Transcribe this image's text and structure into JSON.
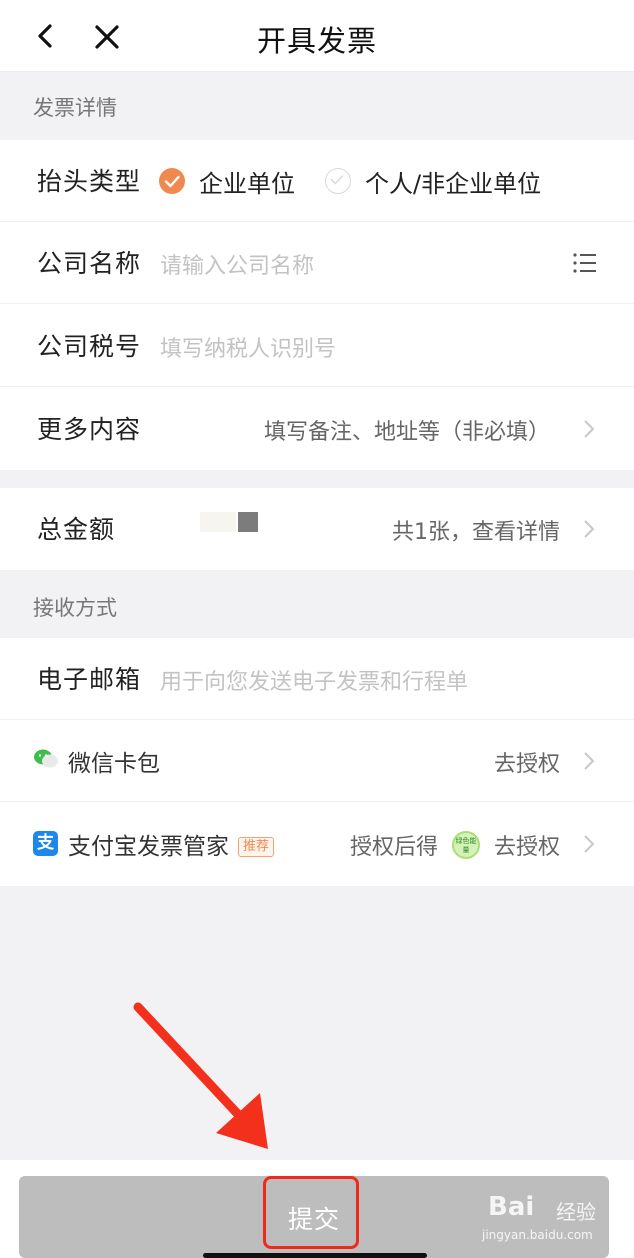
{
  "header": {
    "title": "开具发票"
  },
  "invoice_section": {
    "label": "发票详情",
    "title_type": {
      "label": "抬头类型",
      "options": [
        {
          "label": "企业单位",
          "selected": true
        },
        {
          "label": "个人/非企业单位",
          "selected": false
        }
      ]
    },
    "company_name": {
      "label": "公司名称",
      "placeholder": "请输入公司名称"
    },
    "tax_id": {
      "label": "公司税号",
      "placeholder": "填写纳税人识别号"
    },
    "more": {
      "label": "更多内容",
      "value": "填写备注、地址等（非必填）"
    }
  },
  "total": {
    "label": "总金额",
    "detail": "共1张，查看详情"
  },
  "receive_section": {
    "label": "接收方式",
    "email": {
      "label": "电子邮箱",
      "placeholder": "用于向您发送电子发票和行程单"
    },
    "wechat": {
      "label": "微信卡包",
      "action": "去授权"
    },
    "alipay": {
      "label": "支付宝发票管家",
      "badge": "推荐",
      "note": "授权后得",
      "energy_text": "绿色能量",
      "action": "去授权"
    }
  },
  "submit": {
    "label": "提交"
  },
  "watermark": {
    "brand": "Bai",
    "text": "经验",
    "url": "jingyan.baidu.com"
  },
  "colors": {
    "accent": "#f0894f",
    "highlight": "#f02a1a",
    "submit_bg": "#bdbdbd",
    "alipay": "#1e87ea"
  }
}
